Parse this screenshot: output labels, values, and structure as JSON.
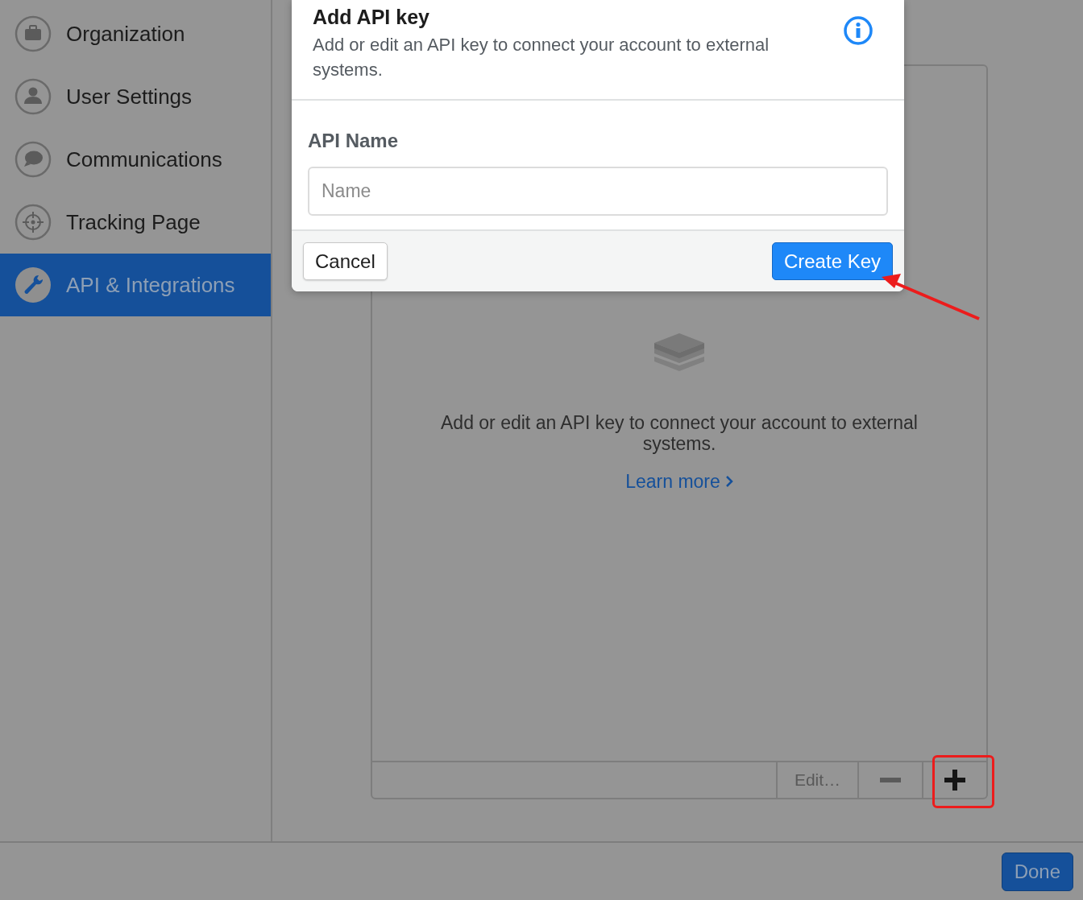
{
  "sidebar": {
    "items": [
      {
        "label": "Organization",
        "kind": "briefcase",
        "selected": false
      },
      {
        "label": "User Settings",
        "kind": "user",
        "selected": false
      },
      {
        "label": "Communications",
        "kind": "chat",
        "selected": false
      },
      {
        "label": "Tracking Page",
        "kind": "target",
        "selected": false
      },
      {
        "label": "API & Integrations",
        "kind": "wrench",
        "selected": true
      }
    ]
  },
  "panel": {
    "empty_message": "Add or edit an API key to connect your account to external systems.",
    "link": "Learn more",
    "toolbar": {
      "edit": "Edit…"
    }
  },
  "footer": {
    "done": "Done"
  },
  "modal": {
    "title": "Add API key",
    "description": "Add or edit an API key to connect your account to external systems.",
    "field": {
      "label": "API Name",
      "placeholder": "Name"
    },
    "buttons": [
      {
        "label": "Cancel",
        "kind": "secondary"
      },
      {
        "label": "Create Key",
        "kind": "primary"
      }
    ]
  }
}
